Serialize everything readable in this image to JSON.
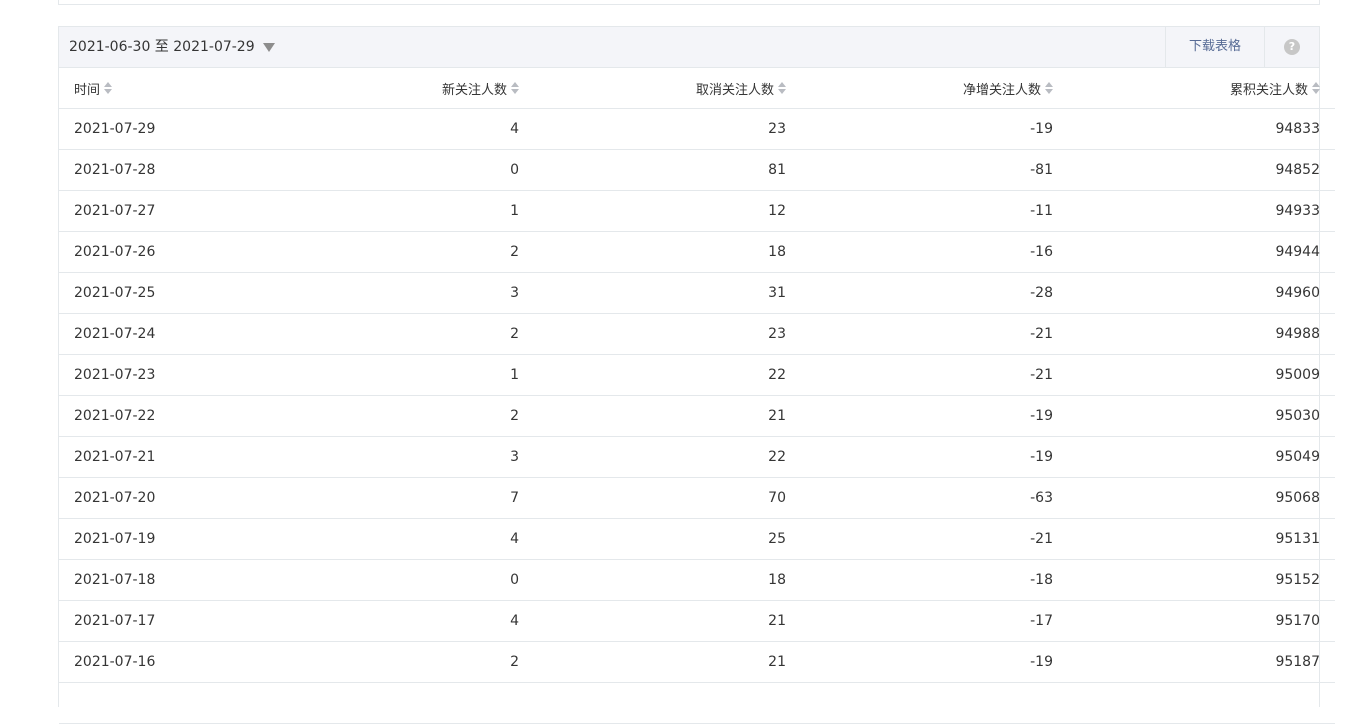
{
  "toolbar": {
    "date_range": "2021-06-30 至 2021-07-29",
    "download_label": "下载表格",
    "help_label": "?"
  },
  "columns": [
    "时间",
    "新关注人数",
    "取消关注人数",
    "净增关注人数",
    "累积关注人数"
  ],
  "rows": [
    [
      "2021-07-29",
      "4",
      "23",
      "-19",
      "94833"
    ],
    [
      "2021-07-28",
      "0",
      "81",
      "-81",
      "94852"
    ],
    [
      "2021-07-27",
      "1",
      "12",
      "-11",
      "94933"
    ],
    [
      "2021-07-26",
      "2",
      "18",
      "-16",
      "94944"
    ],
    [
      "2021-07-25",
      "3",
      "31",
      "-28",
      "94960"
    ],
    [
      "2021-07-24",
      "2",
      "23",
      "-21",
      "94988"
    ],
    [
      "2021-07-23",
      "1",
      "22",
      "-21",
      "95009"
    ],
    [
      "2021-07-22",
      "2",
      "21",
      "-19",
      "95030"
    ],
    [
      "2021-07-21",
      "3",
      "22",
      "-19",
      "95049"
    ],
    [
      "2021-07-20",
      "7",
      "70",
      "-63",
      "95068"
    ],
    [
      "2021-07-19",
      "4",
      "25",
      "-21",
      "95131"
    ],
    [
      "2021-07-18",
      "0",
      "18",
      "-18",
      "95152"
    ],
    [
      "2021-07-17",
      "4",
      "21",
      "-17",
      "95170"
    ],
    [
      "2021-07-16",
      "2",
      "21",
      "-19",
      "95187"
    ],
    [
      "",
      "",
      "",
      "",
      ""
    ]
  ],
  "icons": {
    "dropdown": "caret-down-icon",
    "sort": "sort-icon",
    "help": "question-circle-icon"
  },
  "colors": {
    "toolbar_bg": "#f4f5f9",
    "border": "#e4e8eb",
    "link": "#576b95",
    "text": "#353535"
  }
}
